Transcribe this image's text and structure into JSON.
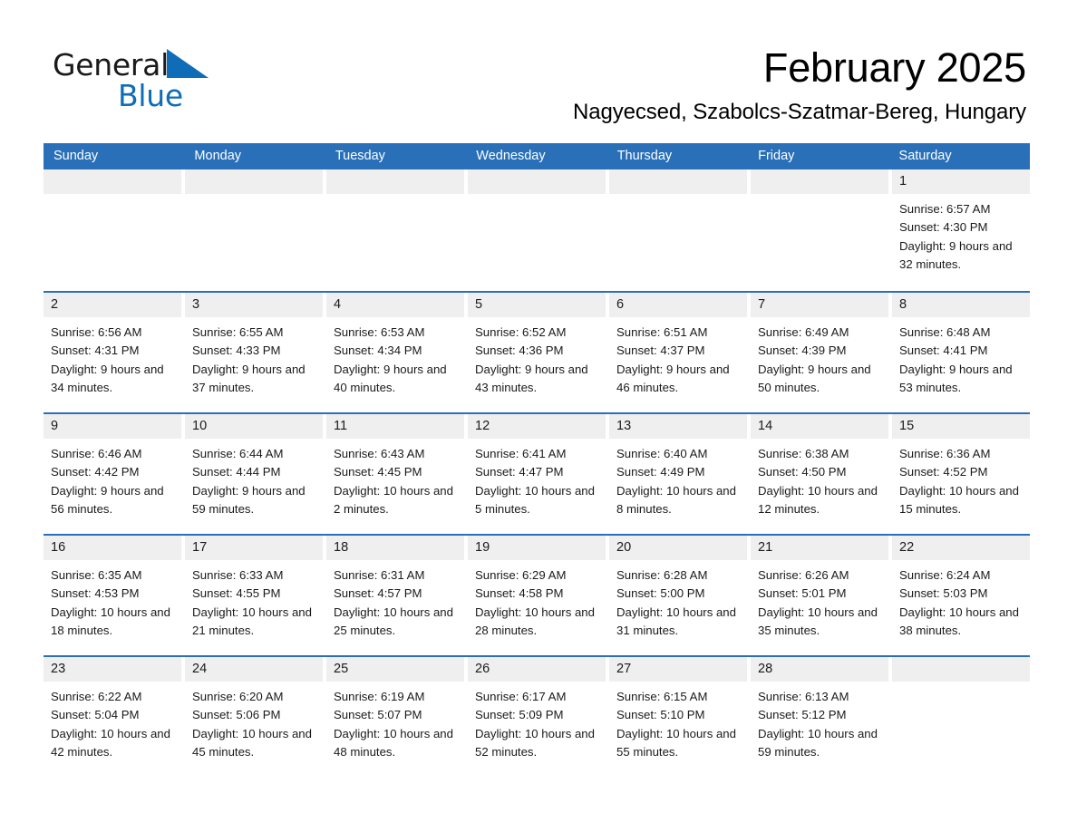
{
  "brand": {
    "name_part1": "General",
    "name_part2": "Blue",
    "accent_color": "#0f6cb6"
  },
  "header": {
    "title": "February 2025",
    "subtitle": "Nagyecsed, Szabolcs-Szatmar-Bereg, Hungary"
  },
  "theme": {
    "header_blue": "#2a70b8",
    "day_strip_gray": "#efefef"
  },
  "calendar": {
    "weekdays": [
      "Sunday",
      "Monday",
      "Tuesday",
      "Wednesday",
      "Thursday",
      "Friday",
      "Saturday"
    ],
    "weeks": [
      [
        {
          "day": "",
          "empty": true
        },
        {
          "day": "",
          "empty": true
        },
        {
          "day": "",
          "empty": true
        },
        {
          "day": "",
          "empty": true
        },
        {
          "day": "",
          "empty": true
        },
        {
          "day": "",
          "empty": true
        },
        {
          "day": "1",
          "sunrise": "Sunrise: 6:57 AM",
          "sunset": "Sunset: 4:30 PM",
          "daylight": "Daylight: 9 hours and 32 minutes."
        }
      ],
      [
        {
          "day": "2",
          "sunrise": "Sunrise: 6:56 AM",
          "sunset": "Sunset: 4:31 PM",
          "daylight": "Daylight: 9 hours and 34 minutes."
        },
        {
          "day": "3",
          "sunrise": "Sunrise: 6:55 AM",
          "sunset": "Sunset: 4:33 PM",
          "daylight": "Daylight: 9 hours and 37 minutes."
        },
        {
          "day": "4",
          "sunrise": "Sunrise: 6:53 AM",
          "sunset": "Sunset: 4:34 PM",
          "daylight": "Daylight: 9 hours and 40 minutes."
        },
        {
          "day": "5",
          "sunrise": "Sunrise: 6:52 AM",
          "sunset": "Sunset: 4:36 PM",
          "daylight": "Daylight: 9 hours and 43 minutes."
        },
        {
          "day": "6",
          "sunrise": "Sunrise: 6:51 AM",
          "sunset": "Sunset: 4:37 PM",
          "daylight": "Daylight: 9 hours and 46 minutes."
        },
        {
          "day": "7",
          "sunrise": "Sunrise: 6:49 AM",
          "sunset": "Sunset: 4:39 PM",
          "daylight": "Daylight: 9 hours and 50 minutes."
        },
        {
          "day": "8",
          "sunrise": "Sunrise: 6:48 AM",
          "sunset": "Sunset: 4:41 PM",
          "daylight": "Daylight: 9 hours and 53 minutes."
        }
      ],
      [
        {
          "day": "9",
          "sunrise": "Sunrise: 6:46 AM",
          "sunset": "Sunset: 4:42 PM",
          "daylight": "Daylight: 9 hours and 56 minutes."
        },
        {
          "day": "10",
          "sunrise": "Sunrise: 6:44 AM",
          "sunset": "Sunset: 4:44 PM",
          "daylight": "Daylight: 9 hours and 59 minutes."
        },
        {
          "day": "11",
          "sunrise": "Sunrise: 6:43 AM",
          "sunset": "Sunset: 4:45 PM",
          "daylight": "Daylight: 10 hours and 2 minutes."
        },
        {
          "day": "12",
          "sunrise": "Sunrise: 6:41 AM",
          "sunset": "Sunset: 4:47 PM",
          "daylight": "Daylight: 10 hours and 5 minutes."
        },
        {
          "day": "13",
          "sunrise": "Sunrise: 6:40 AM",
          "sunset": "Sunset: 4:49 PM",
          "daylight": "Daylight: 10 hours and 8 minutes."
        },
        {
          "day": "14",
          "sunrise": "Sunrise: 6:38 AM",
          "sunset": "Sunset: 4:50 PM",
          "daylight": "Daylight: 10 hours and 12 minutes."
        },
        {
          "day": "15",
          "sunrise": "Sunrise: 6:36 AM",
          "sunset": "Sunset: 4:52 PM",
          "daylight": "Daylight: 10 hours and 15 minutes."
        }
      ],
      [
        {
          "day": "16",
          "sunrise": "Sunrise: 6:35 AM",
          "sunset": "Sunset: 4:53 PM",
          "daylight": "Daylight: 10 hours and 18 minutes."
        },
        {
          "day": "17",
          "sunrise": "Sunrise: 6:33 AM",
          "sunset": "Sunset: 4:55 PM",
          "daylight": "Daylight: 10 hours and 21 minutes."
        },
        {
          "day": "18",
          "sunrise": "Sunrise: 6:31 AM",
          "sunset": "Sunset: 4:57 PM",
          "daylight": "Daylight: 10 hours and 25 minutes."
        },
        {
          "day": "19",
          "sunrise": "Sunrise: 6:29 AM",
          "sunset": "Sunset: 4:58 PM",
          "daylight": "Daylight: 10 hours and 28 minutes."
        },
        {
          "day": "20",
          "sunrise": "Sunrise: 6:28 AM",
          "sunset": "Sunset: 5:00 PM",
          "daylight": "Daylight: 10 hours and 31 minutes."
        },
        {
          "day": "21",
          "sunrise": "Sunrise: 6:26 AM",
          "sunset": "Sunset: 5:01 PM",
          "daylight": "Daylight: 10 hours and 35 minutes."
        },
        {
          "day": "22",
          "sunrise": "Sunrise: 6:24 AM",
          "sunset": "Sunset: 5:03 PM",
          "daylight": "Daylight: 10 hours and 38 minutes."
        }
      ],
      [
        {
          "day": "23",
          "sunrise": "Sunrise: 6:22 AM",
          "sunset": "Sunset: 5:04 PM",
          "daylight": "Daylight: 10 hours and 42 minutes."
        },
        {
          "day": "24",
          "sunrise": "Sunrise: 6:20 AM",
          "sunset": "Sunset: 5:06 PM",
          "daylight": "Daylight: 10 hours and 45 minutes."
        },
        {
          "day": "25",
          "sunrise": "Sunrise: 6:19 AM",
          "sunset": "Sunset: 5:07 PM",
          "daylight": "Daylight: 10 hours and 48 minutes."
        },
        {
          "day": "26",
          "sunrise": "Sunrise: 6:17 AM",
          "sunset": "Sunset: 5:09 PM",
          "daylight": "Daylight: 10 hours and 52 minutes."
        },
        {
          "day": "27",
          "sunrise": "Sunrise: 6:15 AM",
          "sunset": "Sunset: 5:10 PM",
          "daylight": "Daylight: 10 hours and 55 minutes."
        },
        {
          "day": "28",
          "sunrise": "Sunrise: 6:13 AM",
          "sunset": "Sunset: 5:12 PM",
          "daylight": "Daylight: 10 hours and 59 minutes."
        },
        {
          "day": "",
          "empty": true
        }
      ]
    ]
  }
}
